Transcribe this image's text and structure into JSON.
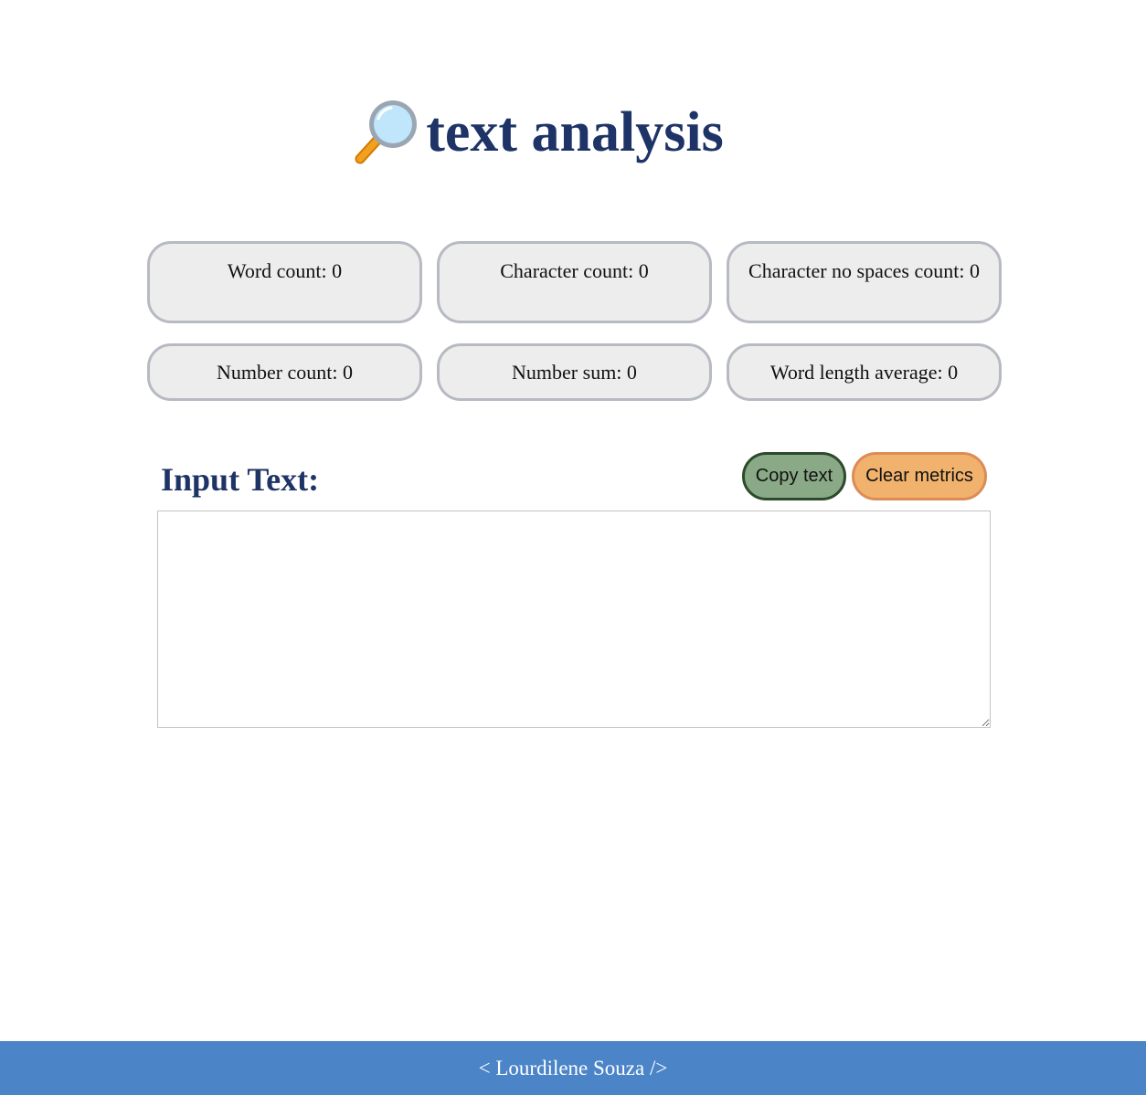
{
  "header": {
    "icon": "magnifying-glass-icon",
    "title": "text analysis"
  },
  "metrics": [
    {
      "label": "Word count: 0"
    },
    {
      "label": "Character count: 0"
    },
    {
      "label": "Character no spaces count: 0"
    },
    {
      "label": "Number count: 0"
    },
    {
      "label": "Number sum: 0"
    },
    {
      "label": "Word length average: 0"
    }
  ],
  "input_section": {
    "label": "Input Text:",
    "copy_button": "Copy text",
    "clear_button": "Clear metrics",
    "textarea_value": "",
    "textarea_placeholder": ""
  },
  "footer": {
    "text": "< Lourdilene Souza />"
  },
  "colors": {
    "title": "#1e3366",
    "metric_bg": "#ededed",
    "metric_border": "#b7bac3",
    "copy_bg": "#8aa986",
    "copy_border": "#2c4a2c",
    "clear_bg": "#f0b26c",
    "clear_border": "#dd8b57",
    "footer_bg": "#4b84c7"
  }
}
